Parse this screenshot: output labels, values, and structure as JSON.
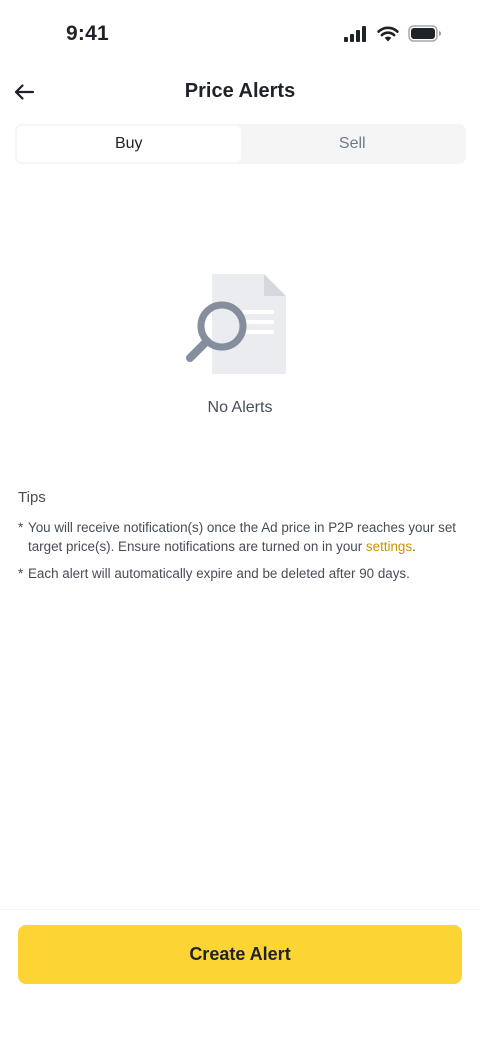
{
  "status_bar": {
    "time": "9:41",
    "icons": [
      "signal-icon",
      "wifi-icon",
      "battery-icon"
    ]
  },
  "header": {
    "title": "Price Alerts",
    "back_icon": "arrow-left-icon"
  },
  "tabs": [
    {
      "label": "Buy",
      "active": true
    },
    {
      "label": "Sell",
      "active": false
    }
  ],
  "empty_state": {
    "icon": "document-search-icon",
    "text": "No Alerts"
  },
  "tips": {
    "title": "Tips",
    "bullet": "*",
    "items": [
      {
        "text": "You will receive notification(s) once the Ad price in P2P reaches your set target price(s). Ensure notifications are turned on in your ",
        "link": "settings",
        "suffix": "."
      },
      {
        "text": "Each alert will automatically expire and be deleted after 90 days."
      }
    ]
  },
  "create_button": {
    "label": "Create Alert"
  },
  "colors": {
    "accent": "#fcd535",
    "link": "#c99400",
    "text_primary": "#1e2329",
    "text_secondary": "#474d57",
    "tab_background": "#f5f5f5"
  }
}
